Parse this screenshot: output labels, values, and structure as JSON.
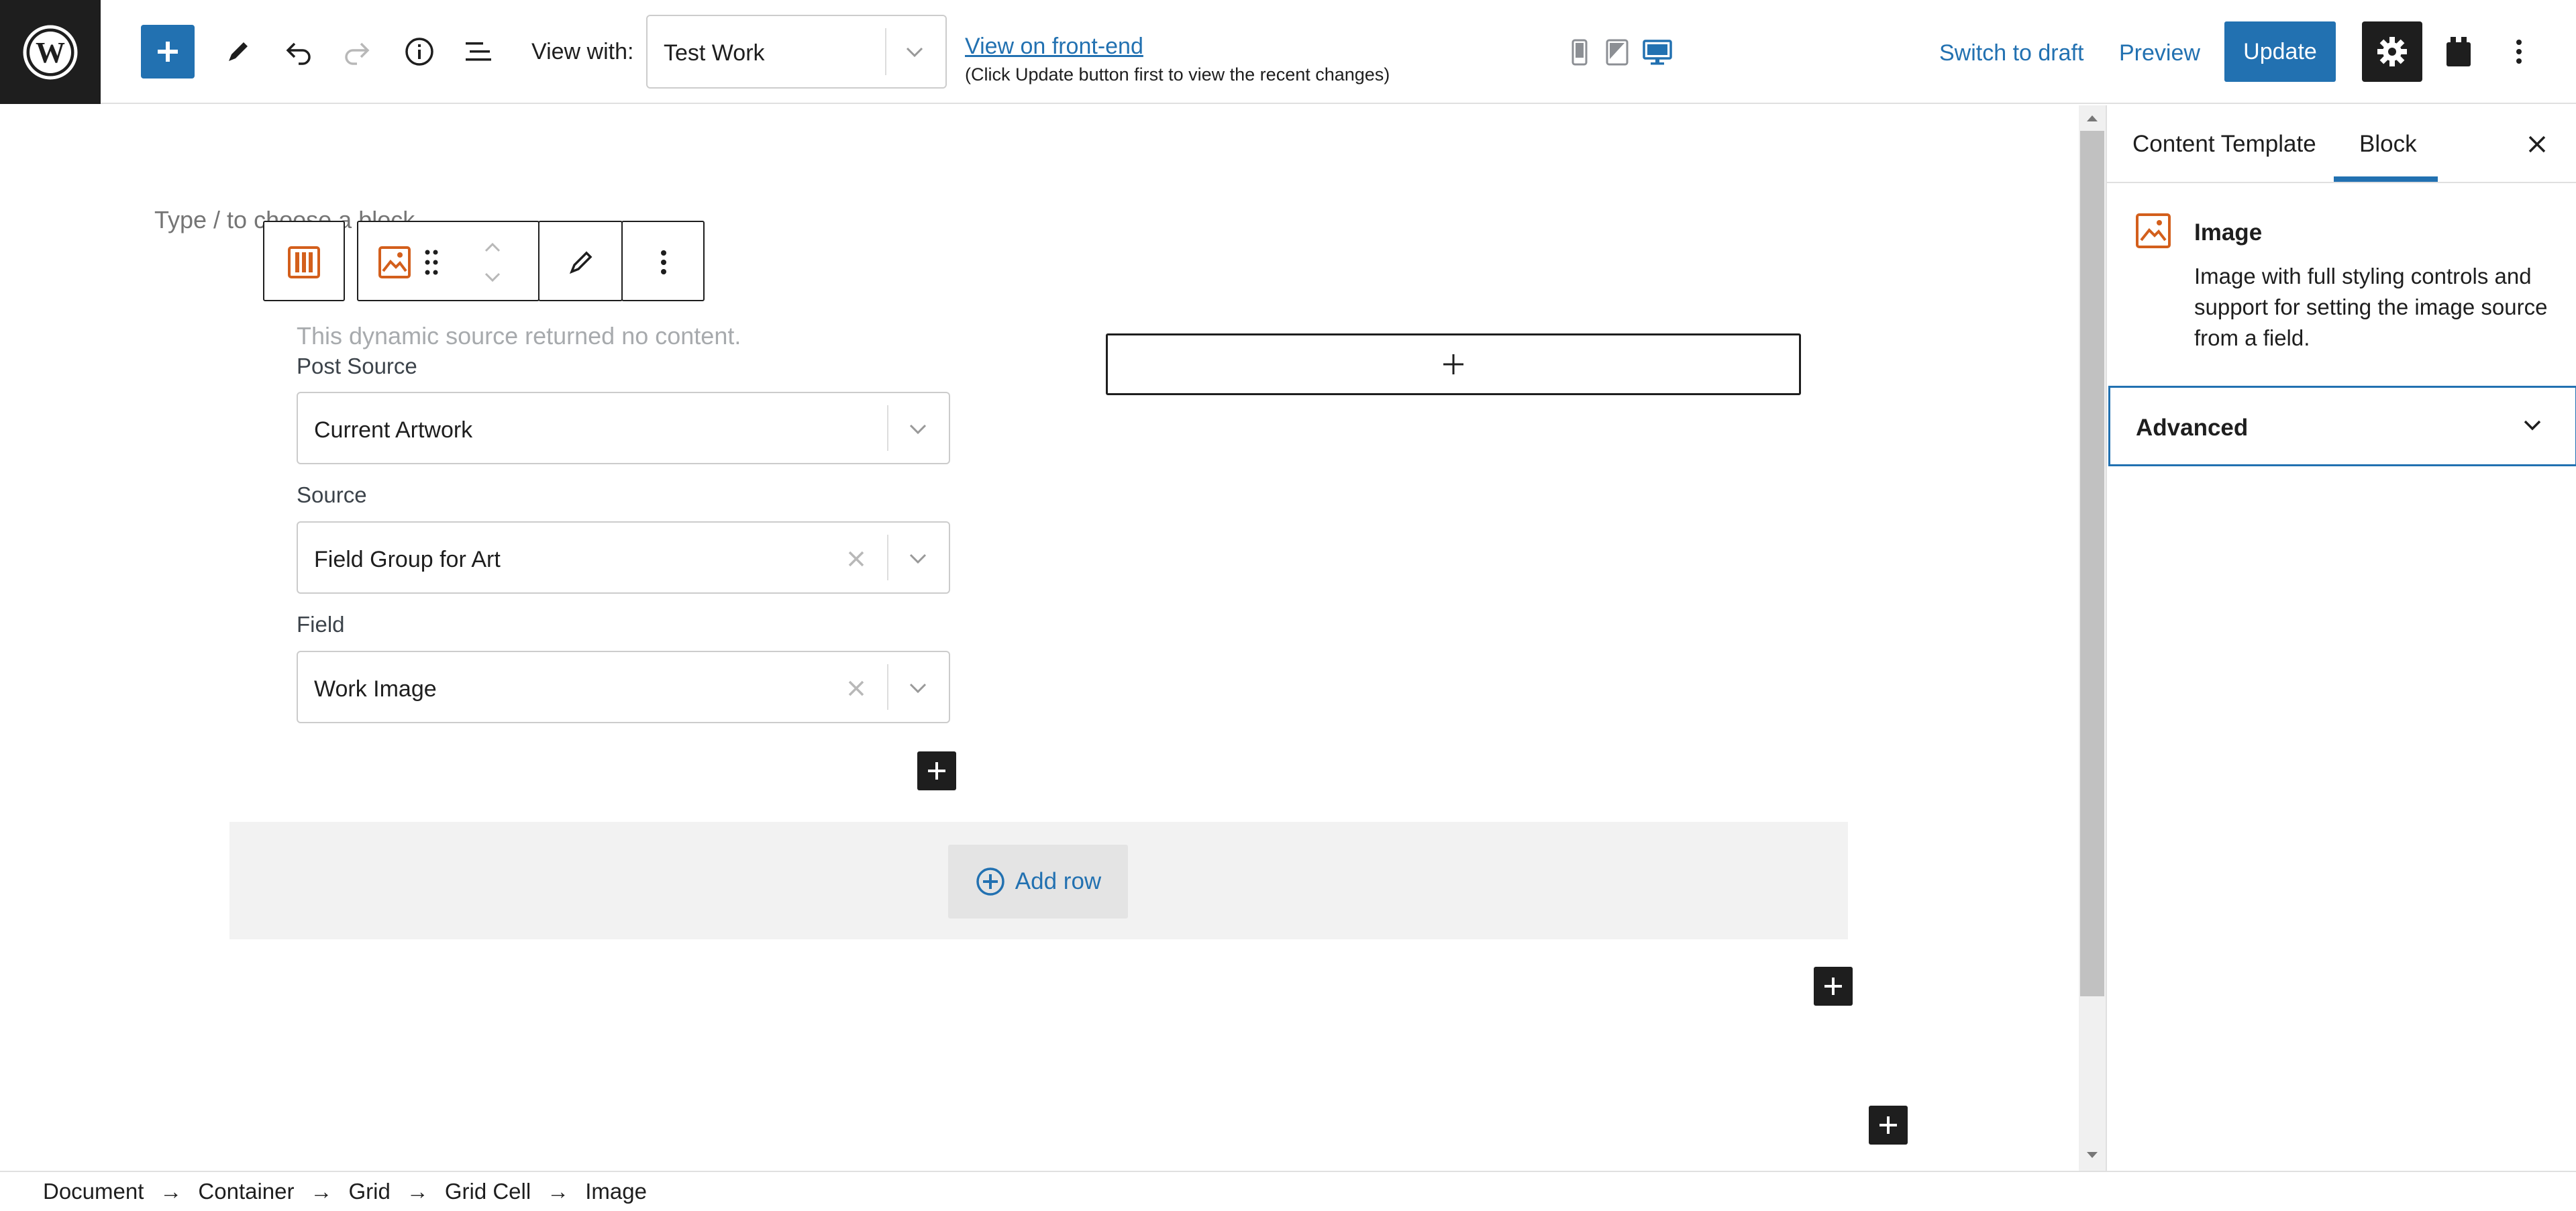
{
  "toolbar": {
    "view_with_label": "View with:",
    "view_with_value": "Test Work",
    "front_end_link": "View on front-end",
    "front_end_note": "(Click Update button first to view the recent changes)",
    "switch_to_draft": "Switch to draft",
    "preview": "Preview",
    "update": "Update",
    "accent_color": "#2271b1"
  },
  "canvas": {
    "placeholder": "Type / to choose a block",
    "no_content": "This dynamic source returned no content.",
    "fields": [
      {
        "label": "Post Source",
        "value": "Current Artwork"
      },
      {
        "label": "Source",
        "value": "Field Group for Art"
      },
      {
        "label": "Field",
        "value": "Work Image"
      }
    ],
    "add_row": "Add row"
  },
  "sidebar": {
    "tabs": [
      "Content Template",
      "Block"
    ],
    "active_tab": "Block",
    "block_title": "Image",
    "block_description": "Image with full styling controls and support for setting the image source from a field.",
    "advanced": "Advanced"
  },
  "breadcrumb": {
    "items": [
      "Document",
      "Container",
      "Grid",
      "Grid Cell",
      "Image"
    ],
    "separator": "→"
  }
}
